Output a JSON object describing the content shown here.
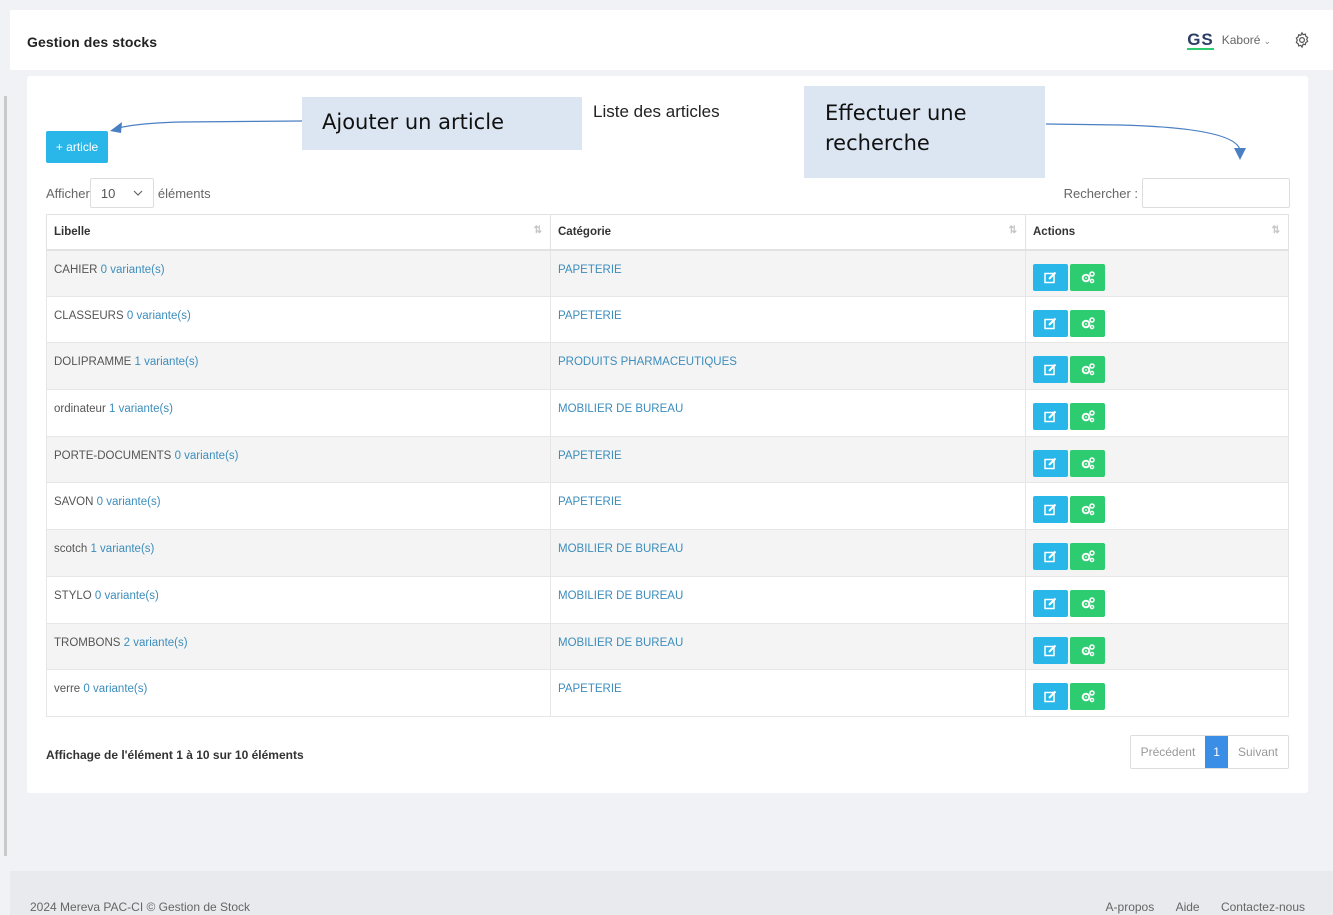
{
  "header": {
    "title": "Gestion des stocks",
    "logo_text": "GS",
    "user_name": "Kaboré",
    "user_chevron": "⌄"
  },
  "toolbar": {
    "add_label": "+ article",
    "list_title": "Liste des articles",
    "length_prefix": "Afficher",
    "length_value": "10",
    "length_suffix": "éléments",
    "search_label": "Rechercher :",
    "search_value": ""
  },
  "annotations": {
    "add_note": "Ajouter un article",
    "search_note_line1": "Effectuer une",
    "search_note_line2": "recherche"
  },
  "table": {
    "headers": [
      "Libelle",
      "Catégorie",
      "Actions"
    ],
    "rows": [
      {
        "name": "CAHIER",
        "variants": "0 variante(s)",
        "category": "PAPETERIE"
      },
      {
        "name": "CLASSEURS",
        "variants": "0 variante(s)",
        "category": "PAPETERIE"
      },
      {
        "name": "DOLIPRAMME",
        "variants": "1 variante(s)",
        "category": "PRODUITS PHARMACEUTIQUES"
      },
      {
        "name": "ordinateur",
        "variants": "1 variante(s)",
        "category": "MOBILIER DE BUREAU"
      },
      {
        "name": "PORTE-DOCUMENTS",
        "variants": "0 variante(s)",
        "category": "PAPETERIE"
      },
      {
        "name": "SAVON",
        "variants": "0 variante(s)",
        "category": "PAPETERIE"
      },
      {
        "name": "scotch",
        "variants": "1 variante(s)",
        "category": "MOBILIER DE BUREAU"
      },
      {
        "name": "STYLO",
        "variants": "0 variante(s)",
        "category": "MOBILIER DE BUREAU"
      },
      {
        "name": "TROMBONS",
        "variants": "2 variante(s)",
        "category": "MOBILIER DE BUREAU"
      },
      {
        "name": "verre",
        "variants": "0 variante(s)",
        "category": "PAPETERIE"
      }
    ]
  },
  "pagination": {
    "info": "Affichage de l'élément 1 à 10 sur 10 éléments",
    "previous": "Précédent",
    "current": "1",
    "next": "Suivant"
  },
  "footer": {
    "copyright": "2024 Mereva PAC-CI © Gestion de Stock",
    "links": [
      "A-propos",
      "Aide",
      "Contactez-nous"
    ]
  },
  "colors": {
    "accent_blue": "#29b6e8",
    "accent_green": "#2ecc71",
    "link": "#3c8dbc",
    "page_active": "#3a8ee6",
    "callout_bg": "#dce6f2"
  }
}
